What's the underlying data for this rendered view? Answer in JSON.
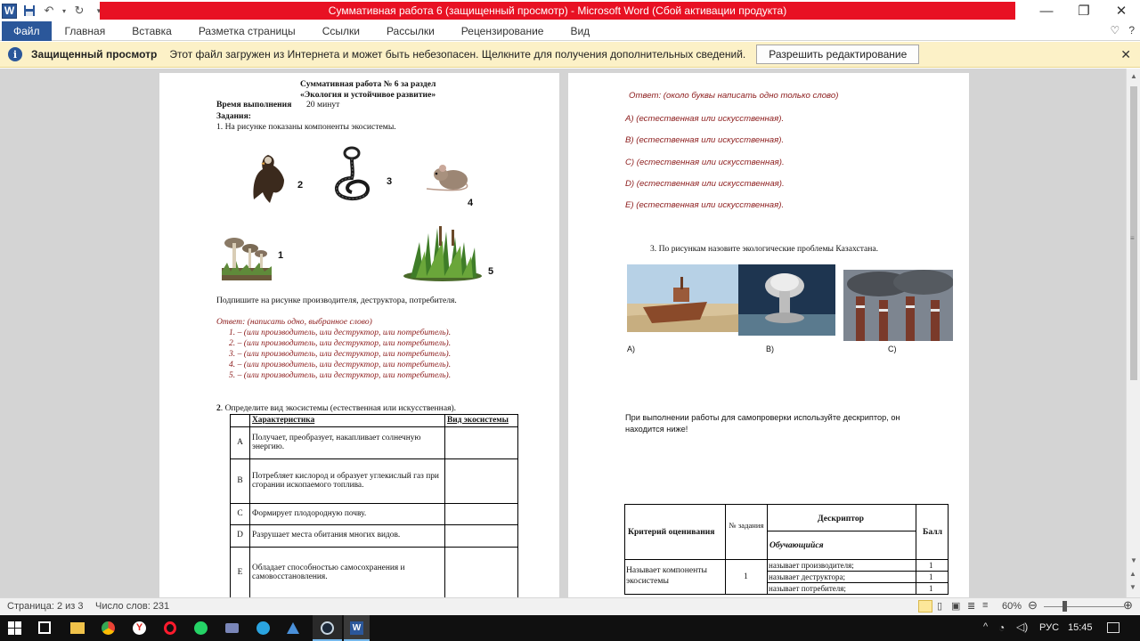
{
  "window": {
    "title": "Суммативная работа 6 (защищенный просмотр)  -  Microsoft Word (Сбой активации продукта)",
    "minimize": "—",
    "restore": "❐",
    "close": "✕"
  },
  "ribbon": {
    "file": "Файл",
    "tabs": [
      "Главная",
      "Вставка",
      "Разметка страницы",
      "Ссылки",
      "Рассылки",
      "Рецензирование",
      "Вид"
    ]
  },
  "protected": {
    "title": "Защищенный просмотр",
    "message": "Этот файл загружен из Интернета и может быть небезопасен. Щелкните для получения дополнительных сведений.",
    "button": "Разрешить редактирование"
  },
  "page1": {
    "title1": "Суммативная работа № 6 за раздел",
    "title2": "«Экология и устойчивое развитие»",
    "time_label": "Время выполнения",
    "time_value": "20 минут",
    "tasks_label": "Задания:",
    "q1": "1.   На рисунке показаны компоненты экосистемы.",
    "fig_numbers": [
      "2",
      "3",
      "4",
      "1",
      "5"
    ],
    "caption": "Подпишите на рисунке производителя, деструктора, потребителя.",
    "answer_header": "Ответ: (написать одно, выбранное слово)",
    "answers": [
      "1.  – (или производитель, или деструктор, или потребитель).",
      "2.  – (или производитель, или деструктор, или потребитель).",
      "3.  – (или производитель, или деструктор, или потребитель).",
      "4.  – (или производитель, или деструктор, или потребитель).",
      "5.  – (или производитель, или деструктор, или потребитель)."
    ],
    "q2_num": "2",
    "q2_text": ". Определите вид экосистемы (естественная или искусственная).",
    "table_headers": [
      "Характеристика",
      "Вид экосистемы"
    ],
    "table_rows": [
      {
        "letter": "A",
        "text": "Получает, преобразует, накапливает солнечную энергию."
      },
      {
        "letter": "B",
        "text": "Потребляет кислород и образует углекислый газ при сгорании ископаемого топлива."
      },
      {
        "letter": "C",
        "text": "Формирует плодородную почву."
      },
      {
        "letter": "D",
        "text": "Разрушает места обитания многих видов."
      },
      {
        "letter": "E",
        "text": "Обладает способностью самосохранения и самовосстановления."
      }
    ]
  },
  "page2": {
    "answer_note": "Ответ:  (около буквы написать одно только слово)",
    "options": [
      "A) (естественная или искусственная).",
      "B) (естественная или искусственная).",
      "C) (естественная или искусственная).",
      "D) (естественная или искусственная).",
      "E) (естественная или искусственная)."
    ],
    "q3": "3.    По рисункам назовите экологические проблемы Казахстана.",
    "img_labels": [
      "A)",
      "B)",
      "C)"
    ],
    "self_check": "При выполнении работы для самопроверки  используйте дескриптор, он находится ниже!",
    "rubric": {
      "criterion_header": "Критерий  оценивания",
      "num_header": "№ задания",
      "descriptor_header": "Дескриптор",
      "learner_header": "Обучающийся",
      "score_header": "Балл",
      "criterion": "Называет  компоненты экосистемы",
      "task_num": "1",
      "descriptors": [
        "называет  производителя;",
        "называет  деструктора;",
        "называет  потребителя;"
      ],
      "scores": [
        "1",
        "1",
        "1"
      ]
    }
  },
  "status": {
    "page": "Страница: 2 из 3",
    "words": "Число слов: 231",
    "zoom": "60%"
  },
  "taskbar": {
    "lang": "РУС",
    "time": "15:45"
  }
}
